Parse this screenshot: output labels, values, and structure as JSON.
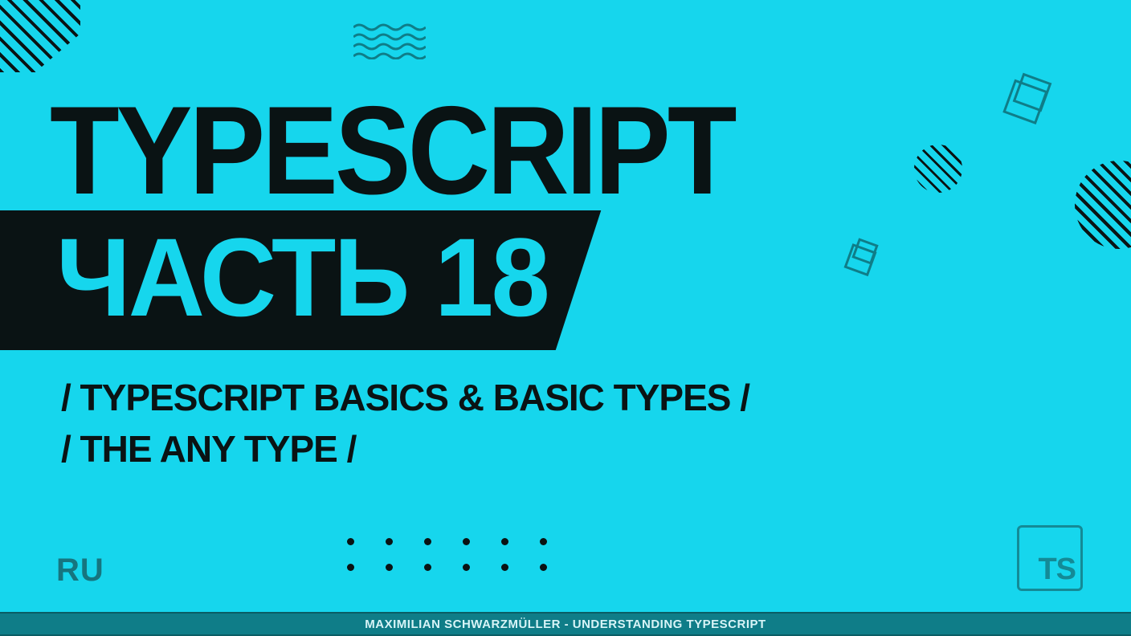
{
  "title": "TYPESCRIPT",
  "part": "ЧАСТЬ 18",
  "subtitle_line1": "/ TYPESCRIPT BASICS & BASIC TYPES /",
  "subtitle_line2": "/ THE ANY TYPE /",
  "lang_label": "RU",
  "ts_logo_text": "TS",
  "footer": "MAXIMILIAN SCHWARZMÜLLER - UNDERSTANDING TYPESCRIPT"
}
